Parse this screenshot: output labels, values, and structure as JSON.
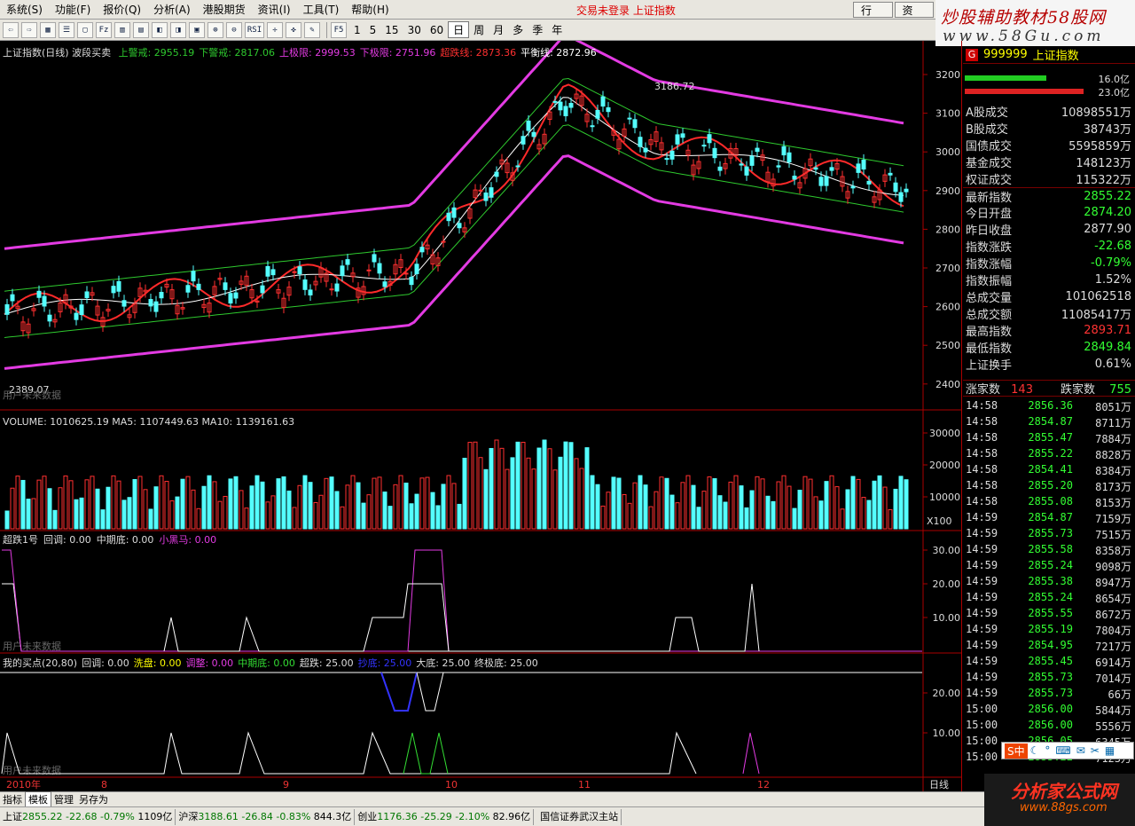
{
  "menu": {
    "items": [
      "系统(S)",
      "功能(F)",
      "报价(Q)",
      "分析(A)",
      "港股期货",
      "资讯(I)",
      "工具(T)",
      "帮助(H)"
    ],
    "login_status": "交易未登录  上证指数",
    "right_buttons": [
      "行 情",
      "资 讯"
    ]
  },
  "toolbar": {
    "icons": [
      "back-icon",
      "forward-icon",
      "grid-icon",
      "list-icon",
      "window-icon",
      "bars-icon",
      "bars2-icon",
      "chart-icon",
      "fill-icon",
      "fill2-icon",
      "calc-icon",
      "zoomin-icon",
      "zoomout-icon",
      "rsi-icon",
      "move-icon",
      "cross-icon",
      "pen-icon",
      "f5-icon"
    ],
    "icon_text": [
      "⇦",
      "⇨",
      "▦",
      "☰",
      "▢",
      "Fz",
      "▥",
      "▤",
      "◧",
      "◨",
      "▣",
      "⊕",
      "⊖",
      "RSI",
      "✛",
      "✜",
      "✎",
      "F5"
    ],
    "periods": [
      "1",
      "5",
      "15",
      "30",
      "60",
      "日",
      "周",
      "月",
      "多",
      "季",
      "年"
    ],
    "active_period": "日"
  },
  "brand": {
    "line1": "炒股辅助教材58股网",
    "line2": "www.58Gu.com"
  },
  "main_chart": {
    "legend_prefix": "上证指数(日线) 波段买卖",
    "legend": [
      {
        "text": "上警戒: 2955.19",
        "color": "#2ec82e"
      },
      {
        "text": "下警戒: 2817.06",
        "color": "#2ec82e"
      },
      {
        "text": "上极限: 2999.53",
        "color": "#e33be3"
      },
      {
        "text": "下极限: 2751.96",
        "color": "#e33be3"
      },
      {
        "text": "超跌线: 2873.36",
        "color": "#ff3030"
      },
      {
        "text": "平衡线: 2872.96",
        "color": "#ffffff"
      }
    ],
    "price_ticks": [
      "3200",
      "3100",
      "3000",
      "2900",
      "2800",
      "2700",
      "2600",
      "2500",
      "2400"
    ],
    "high_label": "3186.72",
    "low_label": "2389.07",
    "note": "用户未来数据"
  },
  "volume_panel": {
    "legend": "VOLUME: 1010625.19  MA5: 1107449.63  MA10: 1139161.63",
    "ticks": [
      "30000",
      "20000",
      "10000"
    ],
    "unit": "X100"
  },
  "ind1": {
    "legend": [
      {
        "text": "超跌1号",
        "color": "#dddddd"
      },
      {
        "text": "回调: 0.00",
        "color": "#dddddd"
      },
      {
        "text": "中期底: 0.00",
        "color": "#dddddd"
      },
      {
        "text": "小黑马: 0.00",
        "color": "#e33be3"
      }
    ],
    "ticks": [
      "30.00",
      "20.00",
      "10.00"
    ],
    "note": "用户未来数据"
  },
  "ind2": {
    "legend": [
      {
        "text": "我的买点(20,80)",
        "color": "#dddddd"
      },
      {
        "text": "回调: 0.00",
        "color": "#dddddd"
      },
      {
        "text": "洗盘: 0.00",
        "color": "#ffff00"
      },
      {
        "text": "调整: 0.00",
        "color": "#e33be3"
      },
      {
        "text": "中期底: 0.00",
        "color": "#33dd33"
      },
      {
        "text": "超跌: 25.00",
        "color": "#dddddd"
      },
      {
        "text": "抄底: 25.00",
        "color": "#3333ff"
      },
      {
        "text": "大底: 25.00",
        "color": "#dddddd"
      },
      {
        "text": "终极底: 25.00",
        "color": "#dddddd"
      }
    ],
    "ticks": [
      "20.00",
      "10.00"
    ],
    "note": "用户未来数据"
  },
  "date_axis": {
    "labels": [
      "2010年",
      "8",
      "9",
      "10",
      "11",
      "12"
    ],
    "corner": "日线"
  },
  "right_panel": {
    "tag": "G",
    "code": "999999",
    "name": "上证指数",
    "bar1_pct": "16.0亿",
    "bar2_pct": "23.0亿",
    "rows": [
      {
        "label": "A股成交",
        "value": "10898551万",
        "color": "#dddddd"
      },
      {
        "label": "B股成交",
        "value": "38743万",
        "color": "#dddddd"
      },
      {
        "label": "国债成交",
        "value": "5595859万",
        "color": "#dddddd"
      },
      {
        "label": "基金成交",
        "value": "148123万",
        "color": "#dddddd"
      },
      {
        "label": "权证成交",
        "value": "115322万",
        "color": "#dddddd"
      },
      {
        "label": "最新指数",
        "value": "2855.22",
        "color": "#33ff33"
      },
      {
        "label": "今日开盘",
        "value": "2874.20",
        "color": "#33ff33"
      },
      {
        "label": "昨日收盘",
        "value": "2877.90",
        "color": "#dddddd"
      },
      {
        "label": "指数涨跌",
        "value": "-22.68",
        "color": "#33ff33"
      },
      {
        "label": "指数涨幅",
        "value": "-0.79%",
        "color": "#33ff33"
      },
      {
        "label": "指数振幅",
        "value": "1.52%",
        "color": "#dddddd"
      },
      {
        "label": "总成交量",
        "value": "101062518",
        "color": "#dddddd"
      },
      {
        "label": "总成交额",
        "value": "11085417万",
        "color": "#dddddd"
      },
      {
        "label": "最高指数",
        "value": "2893.71",
        "color": "#ff3333"
      },
      {
        "label": "最低指数",
        "value": "2849.84",
        "color": "#33ff33"
      },
      {
        "label": "上证换手",
        "value": "0.61%",
        "color": "#dddddd"
      }
    ],
    "rise_label": "涨家数",
    "rise_value": "143",
    "fall_label": "跌家数",
    "fall_value": "755",
    "trades": [
      {
        "t": "14:58",
        "p": "2856.36",
        "v": "8051万"
      },
      {
        "t": "14:58",
        "p": "2854.87",
        "v": "8711万"
      },
      {
        "t": "14:58",
        "p": "2855.47",
        "v": "7884万"
      },
      {
        "t": "14:58",
        "p": "2855.22",
        "v": "8828万"
      },
      {
        "t": "14:58",
        "p": "2854.41",
        "v": "8384万"
      },
      {
        "t": "14:58",
        "p": "2855.20",
        "v": "8173万"
      },
      {
        "t": "14:58",
        "p": "2855.08",
        "v": "8153万"
      },
      {
        "t": "14:59",
        "p": "2854.87",
        "v": "7159万"
      },
      {
        "t": "14:59",
        "p": "2855.73",
        "v": "7515万"
      },
      {
        "t": "14:59",
        "p": "2855.58",
        "v": "8358万"
      },
      {
        "t": "14:59",
        "p": "2855.24",
        "v": "9098万"
      },
      {
        "t": "14:59",
        "p": "2855.38",
        "v": "8947万"
      },
      {
        "t": "14:59",
        "p": "2855.24",
        "v": "8654万"
      },
      {
        "t": "14:59",
        "p": "2855.55",
        "v": "8672万"
      },
      {
        "t": "14:59",
        "p": "2855.19",
        "v": "7804万"
      },
      {
        "t": "14:59",
        "p": "2854.95",
        "v": "7217万"
      },
      {
        "t": "14:59",
        "p": "2855.45",
        "v": "6914万"
      },
      {
        "t": "14:59",
        "p": "2855.73",
        "v": "7014万"
      },
      {
        "t": "14:59",
        "p": "2855.73",
        "v": "66万"
      },
      {
        "t": "15:00",
        "p": "2856.00",
        "v": "5844万"
      },
      {
        "t": "15:00",
        "p": "2856.00",
        "v": "5556万"
      },
      {
        "t": "15:00",
        "p": "2856.05",
        "v": "6345万"
      },
      {
        "t": "15:00",
        "p": "2855.22",
        "v": "7123万"
      }
    ]
  },
  "bottom_tabs": [
    "指标",
    "模板",
    "管理",
    "另存为"
  ],
  "active_tab": "模板",
  "status_bar": {
    "sh_label": "上证",
    "sh_value": "2855.22",
    "sh_change": "-22.68",
    "sh_pct": "-0.79%",
    "sh_amount": "1109亿",
    "hs_label": "沪深",
    "hs_value": "3188.61",
    "hs_change": "-26.84",
    "hs_pct": "-0.83%",
    "hs_amount": "844.3亿",
    "cy_label": "创业",
    "cy_value": "1176.36",
    "cy_change": "-25.29",
    "cy_pct": "-2.10%",
    "cy_amount": "82.96亿",
    "server": "国信证券武汉主站"
  },
  "watermark": {
    "title": "分析家公式网",
    "url": "www.88gs.com"
  },
  "ime": {
    "label": "S中"
  }
}
